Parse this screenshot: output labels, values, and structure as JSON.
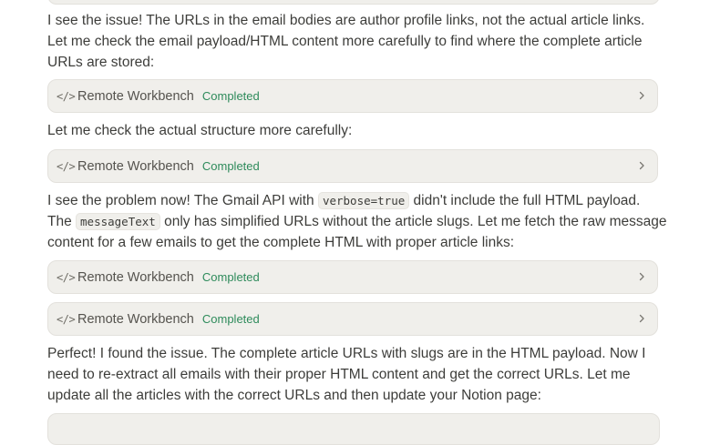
{
  "messages": {
    "p1": {
      "text": "I see the issue! The URLs in the email bodies are author profile links, not the actual article links. Let me check the email payload/HTML content more carefully to find where the complete article URLs are stored:"
    },
    "p2": {
      "text": "Let me check the actual structure more carefully:"
    },
    "p3": {
      "pre": "I see the problem now! The Gmail API with ",
      "code1": "verbose=true",
      "mid": " didn't include the full HTML payload. The ",
      "code2": "messageText",
      "post": " only has simplified URLs without the article slugs. Let me fetch the raw message content for a few emails to get the complete HTML with proper article links:"
    },
    "p4": {
      "text": "Perfect! I found the issue. The complete article URLs with slugs are in the HTML payload. Now I need to re-extract all emails with their proper HTML content and get the correct URLs. Let me update all the articles with the correct URLs and then update your Notion page:"
    }
  },
  "tool_calls": [
    {
      "icon": "code-icon",
      "glyph": "</>",
      "name": "Remote Workbench",
      "status": "Completed"
    },
    {
      "icon": "code-icon",
      "glyph": "</>",
      "name": "Remote Workbench",
      "status": "Completed"
    },
    {
      "icon": "code-icon",
      "glyph": "</>",
      "name": "Remote Workbench",
      "status": "Completed"
    },
    {
      "icon": "code-icon",
      "glyph": "</>",
      "name": "Remote Workbench",
      "status": "Completed"
    }
  ],
  "colors": {
    "status_completed": "#2e8b5b",
    "card_background": "#f0efeb",
    "text": "#3d3d3a"
  }
}
